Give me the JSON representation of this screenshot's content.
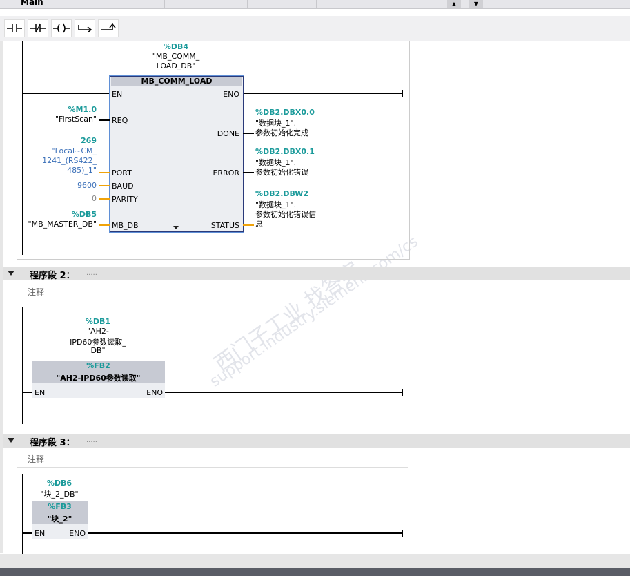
{
  "window": {
    "title": "Main"
  },
  "toolbar": {
    "icons": [
      "no-contact-icon",
      "nc-contact-icon",
      "coil-icon",
      "branch-open-icon",
      "branch-close-icon"
    ]
  },
  "watermark": {
    "line1": "西门子工业 找答案",
    "line2": "support.industry.siemens.com/cs"
  },
  "network1": {
    "instance": {
      "addr": "%DB4",
      "name_l1": "\"MB_COMM_",
      "name_l2": "LOAD_DB\""
    },
    "block": "MB_COMM_LOAD",
    "pins": {
      "en": "EN",
      "eno": "ENO",
      "req": "REQ",
      "done": "DONE",
      "port": "PORT",
      "error": "ERROR",
      "baud": "BAUD",
      "parity": "PARITY",
      "mb_db": "MB_DB",
      "status": "STATUS"
    },
    "req_in": {
      "addr": "%M1.0",
      "name": "\"FirstScan\""
    },
    "port_in": {
      "value": "269",
      "l1": "\"Local~CM_",
      "l2": "1241_(RS422_",
      "l3": "485)_1\""
    },
    "baud_in": "9600",
    "parity_in": "0",
    "mbdb_in": {
      "addr": "%DB5",
      "name": "\"MB_MASTER_DB\""
    },
    "done_out": {
      "addr": "%DB2.DBX0.0",
      "l1": "\"数据块_1\".",
      "l2": "参数初始化完成"
    },
    "error_out": {
      "addr": "%DB2.DBX0.1",
      "l1": "\"数据块_1\".",
      "l2": "参数初始化错误"
    },
    "status_out": {
      "addr": "%DB2.DBW2",
      "l1": "\"数据块_1\".",
      "l2": "参数初始化错误信",
      "l3": "息"
    }
  },
  "network2": {
    "title": "程序段 2：",
    "dots": ".....",
    "comment": "注释",
    "instance": {
      "addr": "%DB1",
      "l1": "\"AH2-",
      "l2": "IPD60参数读取_",
      "l3": "DB\""
    },
    "fb": {
      "addr": "%FB2",
      "name": "\"AH2-IPD60参数读取\""
    },
    "en": "EN",
    "eno": "ENO"
  },
  "network3": {
    "title": "程序段 3：",
    "dots": ".....",
    "comment": "注释",
    "instance": {
      "addr": "%DB6",
      "name": "\"块_2_DB\""
    },
    "fb": {
      "addr": "%FB3",
      "name": "\"块_2\""
    },
    "en": "EN",
    "eno": "ENO"
  }
}
